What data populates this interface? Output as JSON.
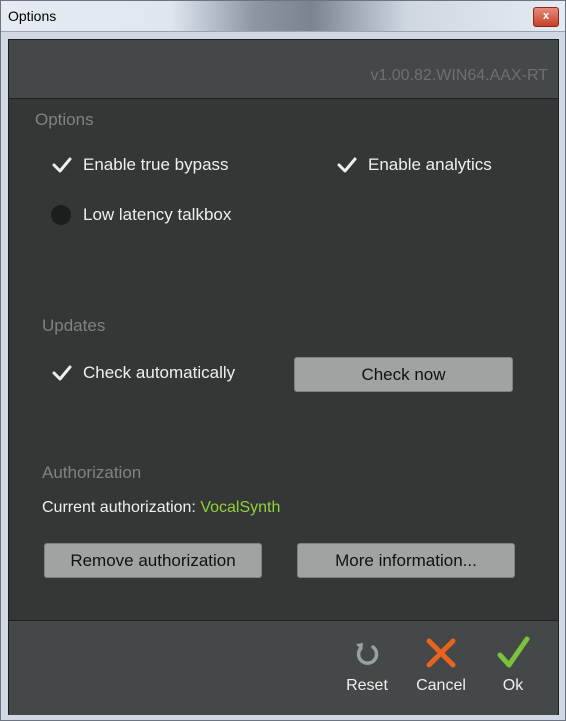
{
  "window": {
    "title": "Options",
    "close_glyph": "x"
  },
  "header": {
    "version": "v1.00.82.WIN64.AAX-RT"
  },
  "options": {
    "title": "Options",
    "enable_true_bypass": {
      "label": "Enable true bypass",
      "checked": true
    },
    "enable_analytics": {
      "label": "Enable analytics",
      "checked": true
    },
    "low_latency_talkbox": {
      "label": "Low latency talkbox",
      "checked": false
    }
  },
  "updates": {
    "title": "Updates",
    "check_automatically": {
      "label": "Check automatically",
      "checked": true
    },
    "check_now_label": "Check now"
  },
  "authorization": {
    "title": "Authorization",
    "current_label": "Current authorization: ",
    "current_value": "VocalSynth",
    "remove_label": "Remove authorization",
    "more_info_label": "More information..."
  },
  "footer": {
    "reset_label": "Reset",
    "cancel_label": "Cancel",
    "ok_label": "Ok"
  },
  "colors": {
    "panel": "#353737",
    "bar": "#454848",
    "accent_green": "#8fd23a",
    "cancel_orange": "#e8641e",
    "ok_green": "#7cc23a"
  },
  "icons": {
    "check": "checkmark-icon",
    "reset": "reset-icon",
    "cancel": "cancel-icon",
    "ok": "ok-icon"
  }
}
